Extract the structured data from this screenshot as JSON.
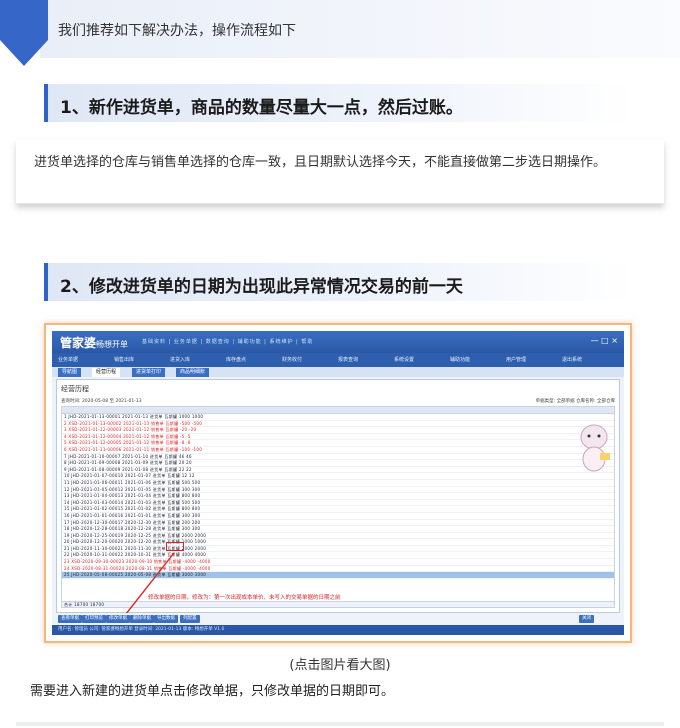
{
  "intro": {
    "text": "我们推荐如下解决办法，操作流程如下"
  },
  "step1": {
    "title": "1、新作进货单，商品的数量尽量大一点，然后过账。"
  },
  "step1_desc": {
    "text": "进货单选择的仓库与销售单选择的仓库一致，且日期默认选择今天，不能直接做第二步选日期操作。"
  },
  "step2": {
    "title": "2、修改进货单的日期为出现此异常情况交易的前一天"
  },
  "screenshot": {
    "logo": "管家婆",
    "logo_sub": "畅想开单",
    "menus": "基础资料 | 业务单据 | 数据查询 | 辅助功能 | 系统维护 | 帮助",
    "window_buttons": "— □ ×",
    "toolbar": [
      "业务单据",
      "销售出库",
      "进货入库",
      "库存盘点",
      "财务收付",
      "报表查询",
      "系统设置",
      "辅助功能",
      "用户管理",
      "退出系统"
    ],
    "tabs": [
      "导航图",
      "经营历程",
      "进货单打印",
      "商品明细账"
    ],
    "pane_title": "经营历程",
    "filter_label": "查询时间: 2020-05-08 至 2021-01-13",
    "right_filter": "单据类型: 全部单据   仓库名称: 全部仓库",
    "rows": [
      "1  JHD-2021-01-13-00001  2021-01-13  进货单  瓦斯罐  1000  1000",
      "2  XSD-2021-01-13-00002  2021-01-13  销售单  瓦斯罐  -500  -500",
      "3  XSD-2021-01-12-00003  2021-01-12  销售单  瓦斯罐  -20  -20",
      "4  XSD-2021-01-12-00004  2021-01-12  销售单  瓦斯罐  -5  -5",
      "5  XSD-2021-01-12-00005  2021-01-12  销售单  瓦斯罐  -8  -8",
      "6  XSD-2021-01-11-00006  2021-01-11  销售单  瓦斯罐  -100  -100",
      "7  JHD-2021-01-10-00007  2021-01-10  进货单  瓦斯罐  46  46",
      "8  JHD-2021-01-09-00008  2021-01-09  进货单  瓦斯罐  20  20",
      "9  JHD-2021-01-08-00009  2021-01-08  进货单  瓦斯罐  22  22",
      "10  JHD-2021-01-07-00010  2021-01-07  进货单  瓦斯罐  12  12",
      "11  JHD-2021-01-06-00011  2021-01-06  进货单  瓦斯罐  500  500",
      "12  JHD-2021-01-05-00012  2021-01-05  进货单  瓦斯罐  300  300",
      "13  JHD-2021-01-04-00013  2021-01-04  进货单  瓦斯罐  800  800",
      "14  JHD-2021-01-03-00014  2021-01-03  进货单  瓦斯罐  500  500",
      "15  JHD-2021-01-02-00015  2021-01-02  进货单  瓦斯罐  800  800",
      "16  JHD-2021-01-01-00016  2021-01-01  进货单  瓦斯罐  300  300",
      "17  JHD-2020-12-30-00017  2020-12-30  进货单  瓦斯罐  200  200",
      "18  JHD-2020-12-28-00018  2020-12-28  进货单  瓦斯罐  300  300",
      "19  JHD-2020-12-25-00019  2020-12-25  进货单  瓦斯罐  2000  2000",
      "20  JHD-2020-12-20-00020  2020-12-20  进货单  瓦斯罐  1000  1000",
      "21  JHD-2020-11-30-00021  2020-11-30  进货单  瓦斯罐  2000  2000",
      "22  JHD-2020-10-31-00022  2020-10-31  进货单  瓦斯罐  4000  4000",
      "23  XSD-2020-09-30-00023  2020-09-30  销售单  瓦斯罐  -4000  -4000",
      "24  XSD-2020-08-31-00024  2020-08-31  销售单  瓦斯罐  -4000  -4000",
      "25  JHD-2020-05-08-00025  2020-05-08  进货单  瓦斯罐  3000  3000"
    ],
    "annotation": "修改单据的日期，修改为：第一次出现成本单价、未写入的交易单据的日期之前",
    "footer_total": "合计   18700   18700",
    "bottom_buttons": [
      "查看单据",
      "打印预览",
      "修改单据",
      "删除单据",
      "导出数据",
      "列配置"
    ],
    "bottom_right_button": "关闭",
    "status": "用户名: 管理员   公司: 管家婆畅想开单   登录时间: 2021-01-13   版本: 畅想开单 V1.0"
  },
  "caption": "(点击图片看大图)",
  "bottom_text": "需要进入新建的进货单点击修改单据，只修改单据的日期即可。"
}
